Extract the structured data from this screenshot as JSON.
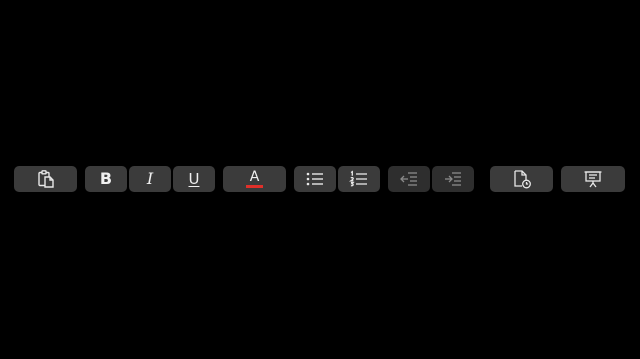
{
  "touch_bar": {
    "buttons": [
      {
        "name": "paste",
        "icon": "clipboard-paste-icon"
      },
      {
        "name": "bold",
        "label": "B",
        "icon": "bold-icon"
      },
      {
        "name": "italic",
        "label": "I",
        "icon": "italic-icon"
      },
      {
        "name": "underline",
        "label": "U",
        "icon": "underline-icon"
      },
      {
        "name": "font-color",
        "label": "A",
        "icon": "font-color-icon",
        "color": "#e0302a"
      },
      {
        "name": "bulleted-list",
        "icon": "bulleted-list-icon"
      },
      {
        "name": "numbered-list",
        "icon": "numbered-list-icon"
      },
      {
        "name": "decrease-indent",
        "icon": "decrease-indent-icon",
        "enabled": false
      },
      {
        "name": "increase-indent",
        "icon": "increase-indent-icon",
        "enabled": false
      },
      {
        "name": "recent-document",
        "icon": "document-clock-icon"
      },
      {
        "name": "presentation",
        "icon": "presentation-icon"
      }
    ]
  },
  "colors": {
    "background": "#000000",
    "button": "#3b3b3b",
    "button_disabled": "#2e2e2e",
    "icon": "#e8e8e8",
    "font_color_bar": "#e0302a"
  }
}
